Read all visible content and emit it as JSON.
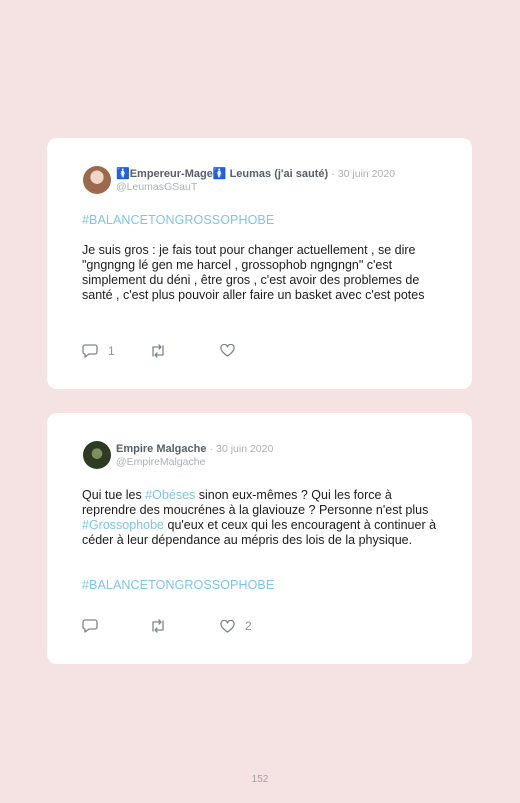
{
  "tweets": [
    {
      "display_name": "🚺Empereur-Mage🚺 Leumas (j'ai sauté)",
      "separator": "·",
      "date": "30 juin 2020",
      "handle": "@LeumasGSauT",
      "hashtag_top": "#BALANCETONGROSSOPHOBE",
      "text": "Je suis gros : je fais tout pour changer actuellement , se dire \"gngngng lé gen me harcel , grossophob ngngngn\" c'est simplement du déni , être gros , c'est avoir des problemes de santé , c'est plus pouvoir aller faire un basket avec c'est potes",
      "reply_count": "1",
      "retweet_count": "",
      "like_count": ""
    },
    {
      "display_name": "Empire Malgache",
      "separator": "·",
      "date": "30 juin 2020",
      "handle": "@EmpireMalgache",
      "text_part1": "Qui tue les ",
      "link1": "#Obéses",
      "text_part2": " sinon eux-mêmes ? Qui les force à reprendre des moucrénes à la glaviouze ? Personne n'est plus ",
      "link2": "#Grossophobe",
      "text_part3": " qu'eux et ceux qui les encouragent à continuer à céder à leur dépendance au mépris des lois de la physique.",
      "hashtag_bottom": "#BALANCETONGROSSOPHOBE",
      "reply_count": "",
      "retweet_count": "",
      "like_count": "2"
    }
  ],
  "icons": [
    "reply-icon",
    "retweet-icon",
    "like-icon"
  ],
  "colors": {
    "background": "#f5e3e4",
    "card": "#ffffff",
    "link": "#7ec4e6",
    "muted": "#a9b0b7"
  },
  "page_number": "152"
}
